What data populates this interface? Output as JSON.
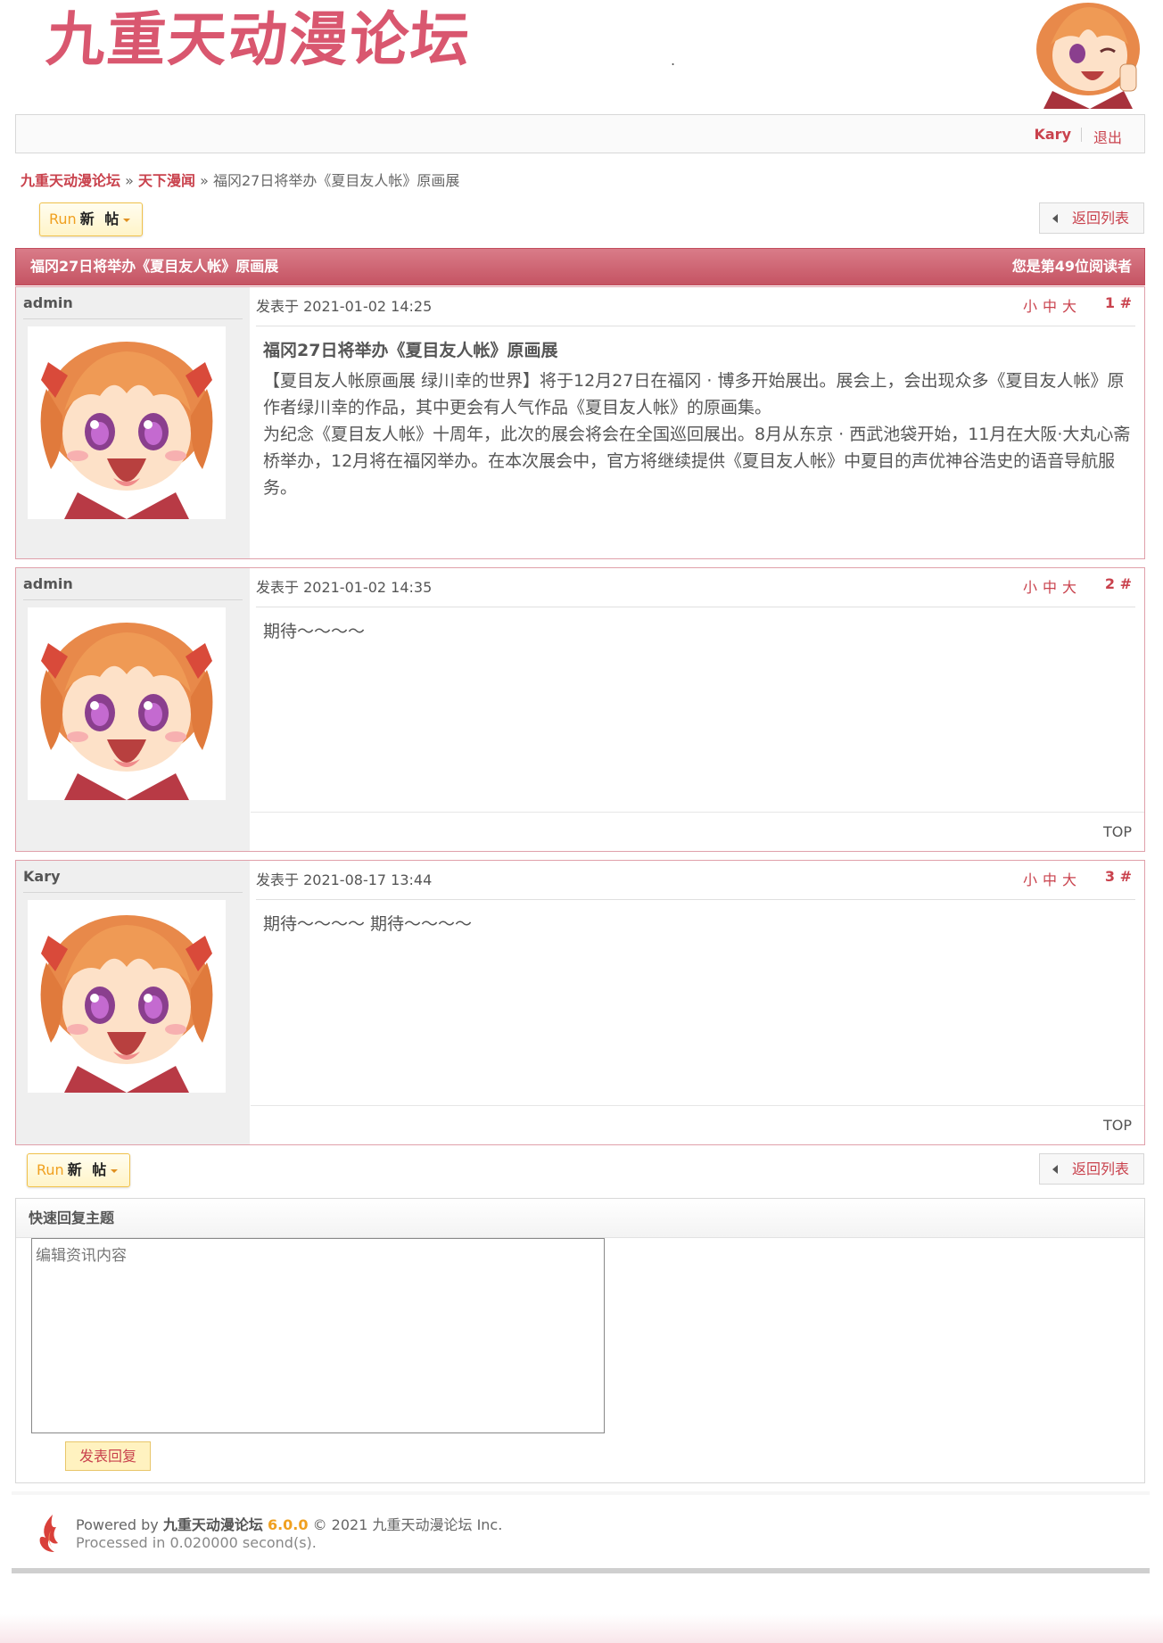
{
  "header": {
    "logo_text": "九重天动漫论坛",
    "dot": "."
  },
  "topbar": {
    "username": "Kary",
    "logout": "退出"
  },
  "breadcrumb": {
    "home": "九重天动漫论坛",
    "section": "天下漫闻",
    "sep": "»",
    "current": "福冈27日将举办《夏目友人帐》原画展"
  },
  "toolbar": {
    "new_run": "Run",
    "new_label": "新 帖",
    "back_label": "返回列表"
  },
  "thread": {
    "title": "福冈27日将举办《夏目友人帐》原画展",
    "readers": "您是第49位阅读者"
  },
  "posts": [
    {
      "author": "admin",
      "time": "发表于 2021-01-02 14:25",
      "size_small": "小",
      "size_mid": "中",
      "size_big": "大",
      "floor": "1 #",
      "title": "福冈27日将举办《夏目友人帐》原画展",
      "p1": "【夏目友人帐原画展 绿川幸的世界】将于12月27日在福冈 · 博多开始展出。展会上，会出现众多《夏目友人帐》原作者绿川幸的作品，其中更会有人气作品《夏目友人帐》的原画集。",
      "p2": "为纪念《夏目友人帐》十周年，此次的展会将会在全国巡回展出。8月从东京 · 西武池袋开始，11月在大阪·大丸心斋桥举办，12月将在福冈举办。在本次展会中，官方将继续提供《夏目友人帐》中夏目的声优神谷浩史的语音导航服务。"
    },
    {
      "author": "admin",
      "time": "发表于 2021-01-02 14:35",
      "size_small": "小",
      "size_mid": "中",
      "size_big": "大",
      "floor": "2 #",
      "content": "期待～～～～",
      "top": "TOP"
    },
    {
      "author": "Kary",
      "time": "发表于 2021-08-17 13:44",
      "size_small": "小",
      "size_mid": "中",
      "size_big": "大",
      "floor": "3 #",
      "content": "期待～～～～  期待～～～～",
      "top": "TOP"
    }
  ],
  "quick_reply": {
    "title": "快速回复主题",
    "placeholder": "编辑资讯内容",
    "submit": "发表回复"
  },
  "footer": {
    "powered_by": "Powered by",
    "brand": "九重天动漫论坛",
    "version": "6.0.0",
    "copyright": "© 2021 九重天动漫论坛 Inc.",
    "processed": "Processed in 0.020000 second(s)."
  },
  "colors": {
    "accent": "#c9424d",
    "logo": "#d9576f",
    "header_bar": "#c55463"
  }
}
